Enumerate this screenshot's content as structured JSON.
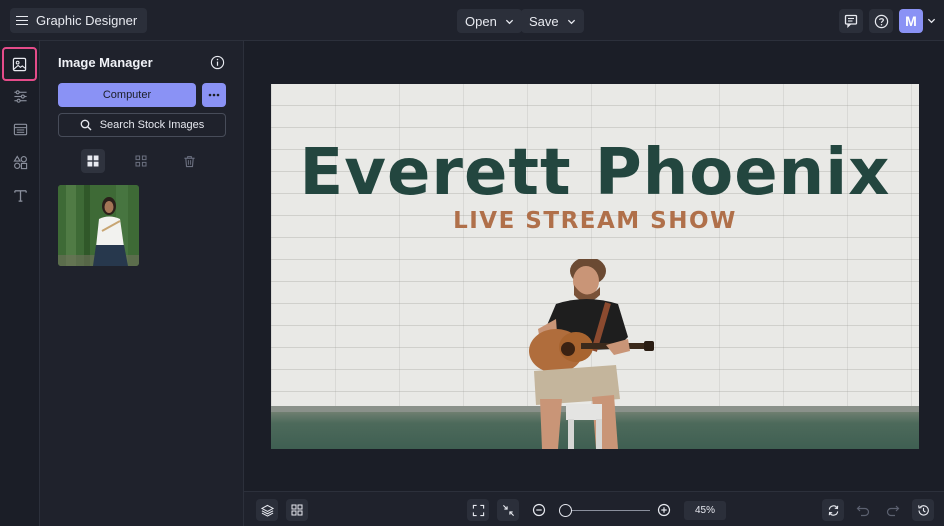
{
  "app": {
    "title": "Graphic Designer"
  },
  "header": {
    "open_label": "Open",
    "save_label": "Save",
    "avatar_initial": "M"
  },
  "rail": {
    "items": [
      {
        "icon": "image-icon",
        "active": true
      },
      {
        "icon": "sliders-icon",
        "active": false
      },
      {
        "icon": "layout-icon",
        "active": false
      },
      {
        "icon": "shapes-icon",
        "active": false
      },
      {
        "icon": "text-icon",
        "active": false
      }
    ]
  },
  "panel": {
    "title": "Image Manager",
    "computer_label": "Computer",
    "search_label": "Search Stock Images",
    "views": [
      "large-grid-icon",
      "small-grid-icon",
      "trash-icon"
    ]
  },
  "design": {
    "title": "Everett Phoenix",
    "subtitle": "LIVE STREAM SHOW"
  },
  "footer": {
    "zoom": "45%",
    "zoom_level": 0.05
  },
  "colors": {
    "accent": "#8a92f5",
    "highlight": "#e54c8a",
    "title_green": "#23463f",
    "subtitle_brown": "#b0704a"
  }
}
